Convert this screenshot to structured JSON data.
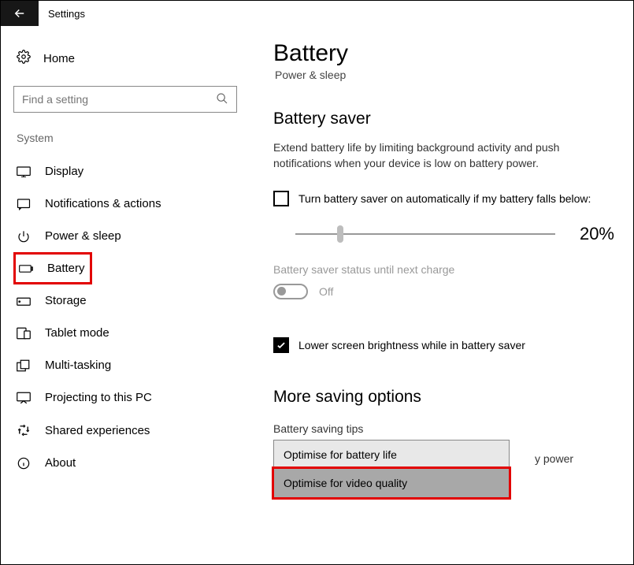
{
  "window": {
    "title": "Settings"
  },
  "sidebar": {
    "home": "Home",
    "search_placeholder": "Find a setting",
    "category": "System",
    "items": [
      {
        "label": "Display"
      },
      {
        "label": "Notifications & actions"
      },
      {
        "label": "Power & sleep"
      },
      {
        "label": "Battery"
      },
      {
        "label": "Storage"
      },
      {
        "label": "Tablet mode"
      },
      {
        "label": "Multi-tasking"
      },
      {
        "label": "Projecting to this PC"
      },
      {
        "label": "Shared experiences"
      },
      {
        "label": "About"
      }
    ]
  },
  "content": {
    "heading": "Battery",
    "breadcrumb": "Power & sleep",
    "section1": {
      "title": "Battery saver",
      "desc": "Extend battery life by limiting background activity and push notifications when your device is low on battery power.",
      "auto_checkbox": "Turn battery saver on automatically if my battery falls below:",
      "percent": "20%",
      "status_label": "Battery saver status until next charge",
      "toggle_state": "Off",
      "brightness_checkbox": "Lower screen brightness while in battery saver"
    },
    "section2": {
      "title": "More saving options",
      "tips_link": "Battery saving tips",
      "behind": "y power",
      "options": [
        "Optimise for battery life",
        "Optimise for video quality"
      ]
    }
  }
}
